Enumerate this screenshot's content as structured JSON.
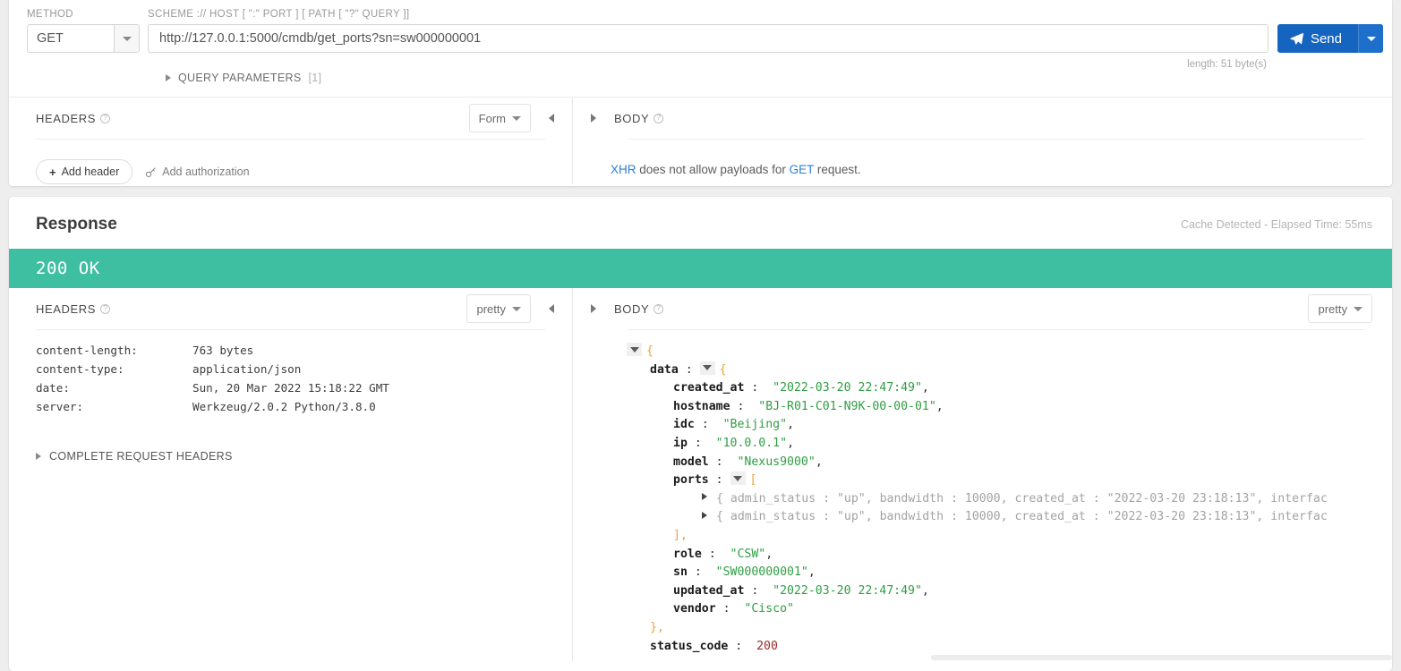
{
  "request": {
    "method_label": "METHOD",
    "method_value": "GET",
    "url_label": "SCHEME :// HOST [ \":\" PORT ] [ PATH [ \"?\" QUERY ]]",
    "url_value": "http://127.0.0.1:5000/cmdb/get_ports?sn=sw000000001",
    "url_length": "length: 51 byte(s)",
    "send_label": "Send",
    "query_parameters_label": "QUERY PARAMETERS",
    "query_parameters_count": "[1]",
    "headers": {
      "title": "HEADERS",
      "mode": "Form",
      "add_header_label": "Add header",
      "add_authorization_label": "Add authorization"
    },
    "body": {
      "title": "BODY",
      "note_prefix": "XHR",
      "note_middle": " does not allow payloads for ",
      "note_method": "GET",
      "note_suffix": " request."
    }
  },
  "response": {
    "title": "Response",
    "meta": "Cache Detected - Elapsed Time: 55ms",
    "status": "200 OK",
    "status_color": "#3ebfa2",
    "headers": {
      "title": "HEADERS",
      "mode": "pretty",
      "rows": [
        {
          "key": "content-length:",
          "value": "763 bytes"
        },
        {
          "key": "content-type:",
          "value": "application/json"
        },
        {
          "key": "date:",
          "value": "Sun, 20 Mar 2022 15:18:22 GMT"
        },
        {
          "key": "server:",
          "value": "Werkzeug/2.0.2 Python/3.8.0"
        }
      ],
      "complete_request_headers_label": "COMPLETE REQUEST HEADERS"
    },
    "body": {
      "title": "BODY",
      "mode": "pretty",
      "json": {
        "root_open": "{",
        "data_key": "data",
        "data_open": "{",
        "fields": [
          {
            "key": "created_at",
            "value": "\"2022-03-20 22:47:49\"",
            "comma": ","
          },
          {
            "key": "hostname",
            "value": "\"BJ-R01-C01-N9K-00-00-01\"",
            "comma": ","
          },
          {
            "key": "idc",
            "value": "\"Beijing\"",
            "comma": ","
          },
          {
            "key": "ip",
            "value": "\"10.0.0.1\"",
            "comma": ","
          },
          {
            "key": "model",
            "value": "\"Nexus9000\"",
            "comma": ","
          }
        ],
        "ports_key": "ports",
        "ports_open": "[",
        "ports_rows": [
          "{ admin_status : \"up\", bandwidth : 10000, created_at : \"2022-03-20 23:18:13\", interfac",
          "{ admin_status : \"up\", bandwidth : 10000, created_at : \"2022-03-20 23:18:13\", interfac"
        ],
        "ports_close": "],",
        "tail_fields": [
          {
            "key": "role",
            "value": "\"CSW\"",
            "comma": ","
          },
          {
            "key": "sn",
            "value": "\"SW000000001\"",
            "comma": ","
          },
          {
            "key": "updated_at",
            "value": "\"2022-03-20 22:47:49\"",
            "comma": ","
          },
          {
            "key": "vendor",
            "value": "\"Cisco\"",
            "comma": ""
          }
        ],
        "data_close": "},",
        "status_code_key": "status_code",
        "status_code_value": "200"
      }
    }
  }
}
